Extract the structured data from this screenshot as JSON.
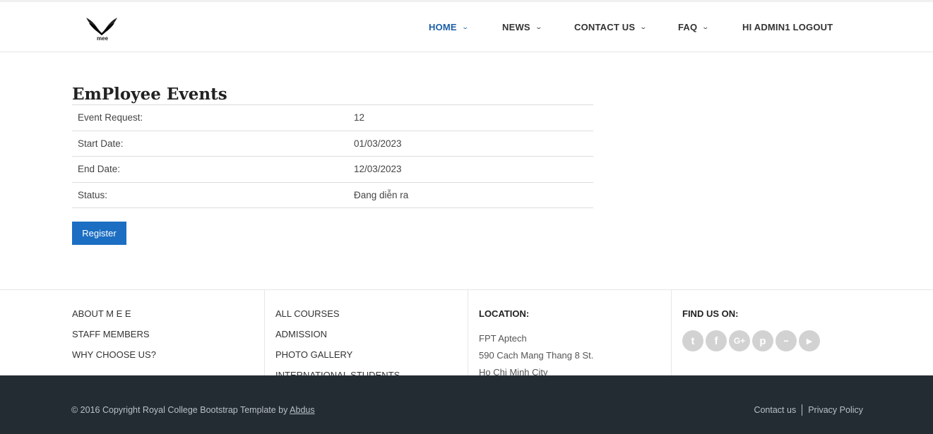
{
  "brand": {
    "logo_text": "mee",
    "logo_icon": "winged-logo-icon"
  },
  "nav": {
    "items": [
      {
        "label": "HOME",
        "has_dropdown": true,
        "active": true
      },
      {
        "label": "NEWS",
        "has_dropdown": true,
        "active": false
      },
      {
        "label": "CONTACT US",
        "has_dropdown": true,
        "active": false
      },
      {
        "label": "FAQ",
        "has_dropdown": true,
        "active": false
      },
      {
        "label": "HI ADMIN1 LOGOUT",
        "has_dropdown": false,
        "active": false
      }
    ],
    "chevron": "⌄"
  },
  "main": {
    "title": "EmPloyee Events",
    "details": [
      {
        "key": "Event Request:",
        "value": "12"
      },
      {
        "key": "Start Date:",
        "value": "01/03/2023"
      },
      {
        "key": "End Date:",
        "value": "12/03/2023"
      },
      {
        "key": "Status:",
        "value": "Đang diễn ra"
      }
    ],
    "register_label": "Register"
  },
  "footer": {
    "col1": [
      "ABOUT M E E",
      "STAFF MEMBERS",
      "WHY CHOOSE US?"
    ],
    "col2": [
      "ALL COURSES",
      "ADMISSION",
      "PHOTO GALLERY",
      "INTERNATIONAL STUDENTS"
    ],
    "location": {
      "heading": "LOCATION:",
      "lines": [
        "FPT Aptech",
        "590 Cach Mang Thang 8 St.",
        "Ho Chi Minh City"
      ]
    },
    "find_us": {
      "heading": "FIND US ON:",
      "icons": [
        {
          "name": "twitter-icon",
          "glyph": "t"
        },
        {
          "name": "facebook-icon",
          "glyph": "f"
        },
        {
          "name": "google-plus-icon",
          "glyph": "G+"
        },
        {
          "name": "pinterest-icon",
          "glyph": "p"
        },
        {
          "name": "flickr-icon",
          "glyph": "••"
        },
        {
          "name": "youtube-icon",
          "glyph": "▶"
        }
      ]
    },
    "copyright_prefix": "© 2016 Copyright Royal College Bootstrap Template by ",
    "copyright_link": "Abdus",
    "contact_link": "Contact us",
    "privacy_link": "Privacy Policy"
  },
  "colors": {
    "accent": "#1b6ec2",
    "nav_active": "#1c5fa8",
    "footer_bg": "#232b33",
    "social_icon_bg": "#d2d2d2"
  }
}
